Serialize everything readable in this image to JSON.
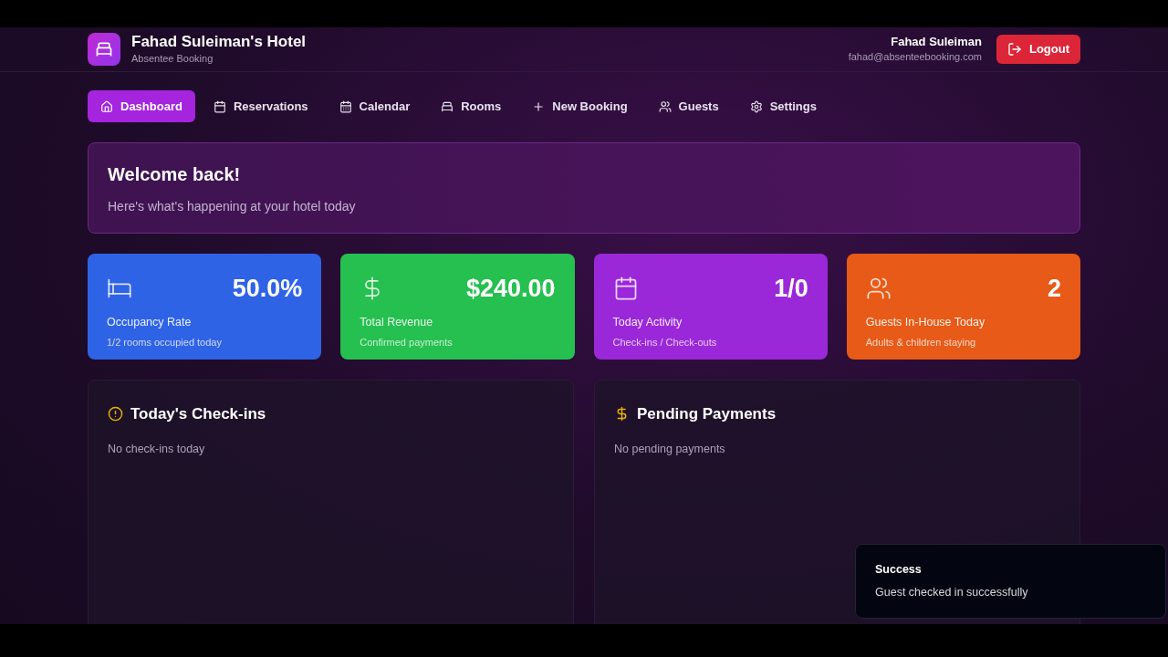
{
  "header": {
    "hotel_name": "Fahad Suleiman's Hotel",
    "subtitle": "Absentee Booking",
    "user_name": "Fahad Suleiman",
    "user_email": "fahad@absenteebooking.com",
    "logout": "Logout"
  },
  "nav": [
    {
      "label": "Dashboard",
      "selected": true
    },
    {
      "label": "Reservations",
      "selected": false
    },
    {
      "label": "Calendar",
      "selected": false
    },
    {
      "label": "Rooms",
      "selected": false
    },
    {
      "label": "New Booking",
      "selected": false
    },
    {
      "label": "Guests",
      "selected": false
    },
    {
      "label": "Settings",
      "selected": false
    }
  ],
  "welcome": {
    "title": "Welcome back!",
    "text": "Here's what's happening at your hotel today"
  },
  "stats": [
    {
      "value": "50.0%",
      "label": "Occupancy Rate",
      "note": "1/2 rooms occupied today",
      "color": "#2f63e6"
    },
    {
      "value": "$240.00",
      "label": "Total Revenue",
      "note": "Confirmed payments",
      "color": "#25c04f"
    },
    {
      "value": "1/0",
      "label": "Today Activity",
      "note": "Check-ins / Check-outs",
      "color": "#9b28d8"
    },
    {
      "value": "2",
      "label": "Guests In-House Today",
      "note": "Adults & children staying",
      "color": "#e85a17"
    }
  ],
  "panels": [
    {
      "title": "Today's Check-ins",
      "empty": "No check-ins today"
    },
    {
      "title": "Pending Payments",
      "empty": "No pending payments"
    }
  ],
  "toast": {
    "title": "Success",
    "message": "Guest checked in successfully"
  }
}
